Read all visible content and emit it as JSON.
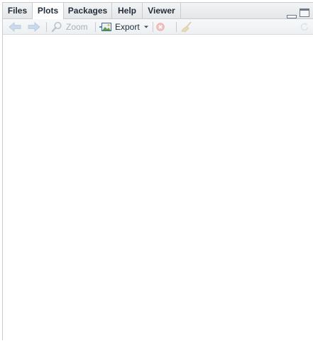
{
  "tabs": [
    {
      "label": "Files"
    },
    {
      "label": "Plots"
    },
    {
      "label": "Packages"
    },
    {
      "label": "Help"
    },
    {
      "label": "Viewer"
    }
  ],
  "active_tab": "Plots",
  "toolbar": {
    "zoom_label": "Zoom",
    "export_label": "Export"
  },
  "icons": {
    "back": "arrow-left-icon",
    "forward": "arrow-right-icon",
    "zoom": "magnifier-icon",
    "export": "image-export-icon",
    "remove": "remove-plot-icon",
    "clear": "broom-icon",
    "refresh": "refresh-icon",
    "minimize": "minimize-icon",
    "maximize": "maximize-icon"
  },
  "colors": {
    "disabled_icon": "#a9b2ba",
    "text": "#1f2d3a",
    "remove_disabled": "#e8a8a8"
  }
}
